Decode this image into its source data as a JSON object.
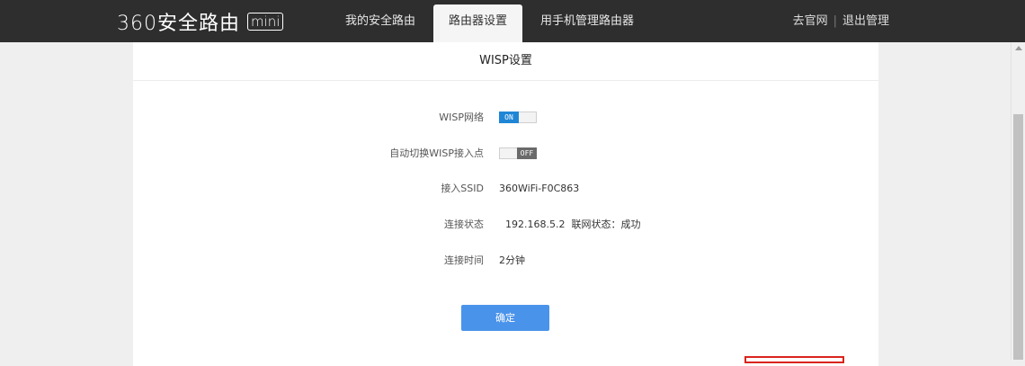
{
  "header": {
    "logo_text": "360安全路由",
    "logo_badge": "mini",
    "tabs": [
      {
        "label": "我的安全路由",
        "active": false
      },
      {
        "label": "路由器设置",
        "active": true
      },
      {
        "label": "用手机管理路由器",
        "active": false
      }
    ],
    "links": {
      "website": "去官网",
      "separator": "|",
      "logout": "退出管理"
    }
  },
  "panel": {
    "title": "WISP设置",
    "rows": [
      {
        "label": "WISP网络",
        "type": "toggle",
        "state": "ON"
      },
      {
        "label": "自动切换WISP接入点",
        "type": "toggle",
        "state": "OFF"
      },
      {
        "label": "接入SSID",
        "value": "360WiFi-F0C863"
      },
      {
        "label": "连接状态",
        "value": "192.168.5.2  联网状态：成功"
      },
      {
        "label": "连接时间",
        "value": "2分钟"
      }
    ],
    "confirm_label": "确定"
  },
  "colors": {
    "topbar": "#2e2e2e",
    "toggle_on": "#1f86d6",
    "toggle_off": "#6a6a6a",
    "button": "#4a93ea",
    "highlight_box": "#d9241c"
  }
}
